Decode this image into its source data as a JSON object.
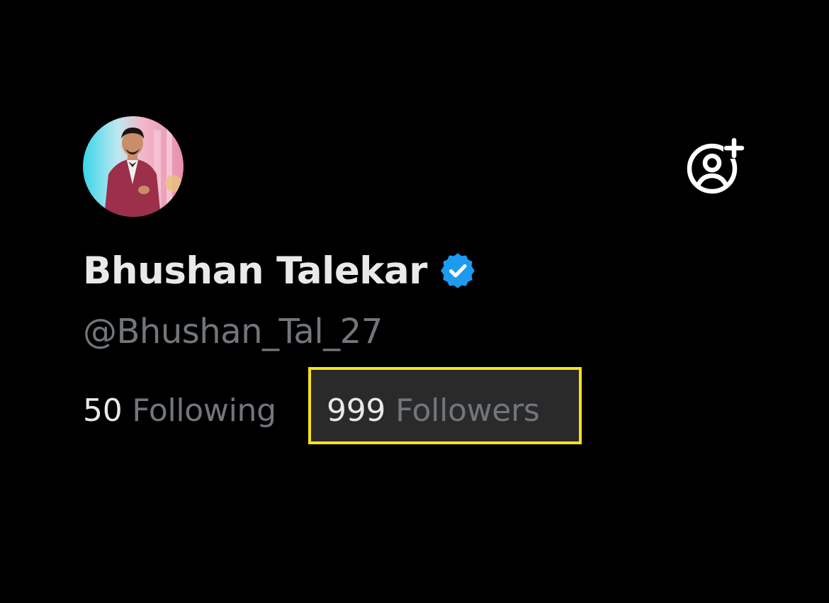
{
  "profile": {
    "display_name": "Bhushan Talekar",
    "handle": "@Bhushan_Tal_27",
    "verified": true,
    "verified_color": "#1d9bf0"
  },
  "stats": {
    "following_count": "50",
    "following_label": "Following",
    "followers_count": "999",
    "followers_label": "Followers"
  },
  "highlight": {
    "color": "#f5e11d"
  },
  "icons": {
    "avatar": "profile-photo",
    "add_friend": "person-add-icon",
    "verified": "verified-badge-icon"
  },
  "colors": {
    "background": "#000000",
    "primary_text": "#e7e9ea",
    "secondary_text": "#71767b"
  }
}
